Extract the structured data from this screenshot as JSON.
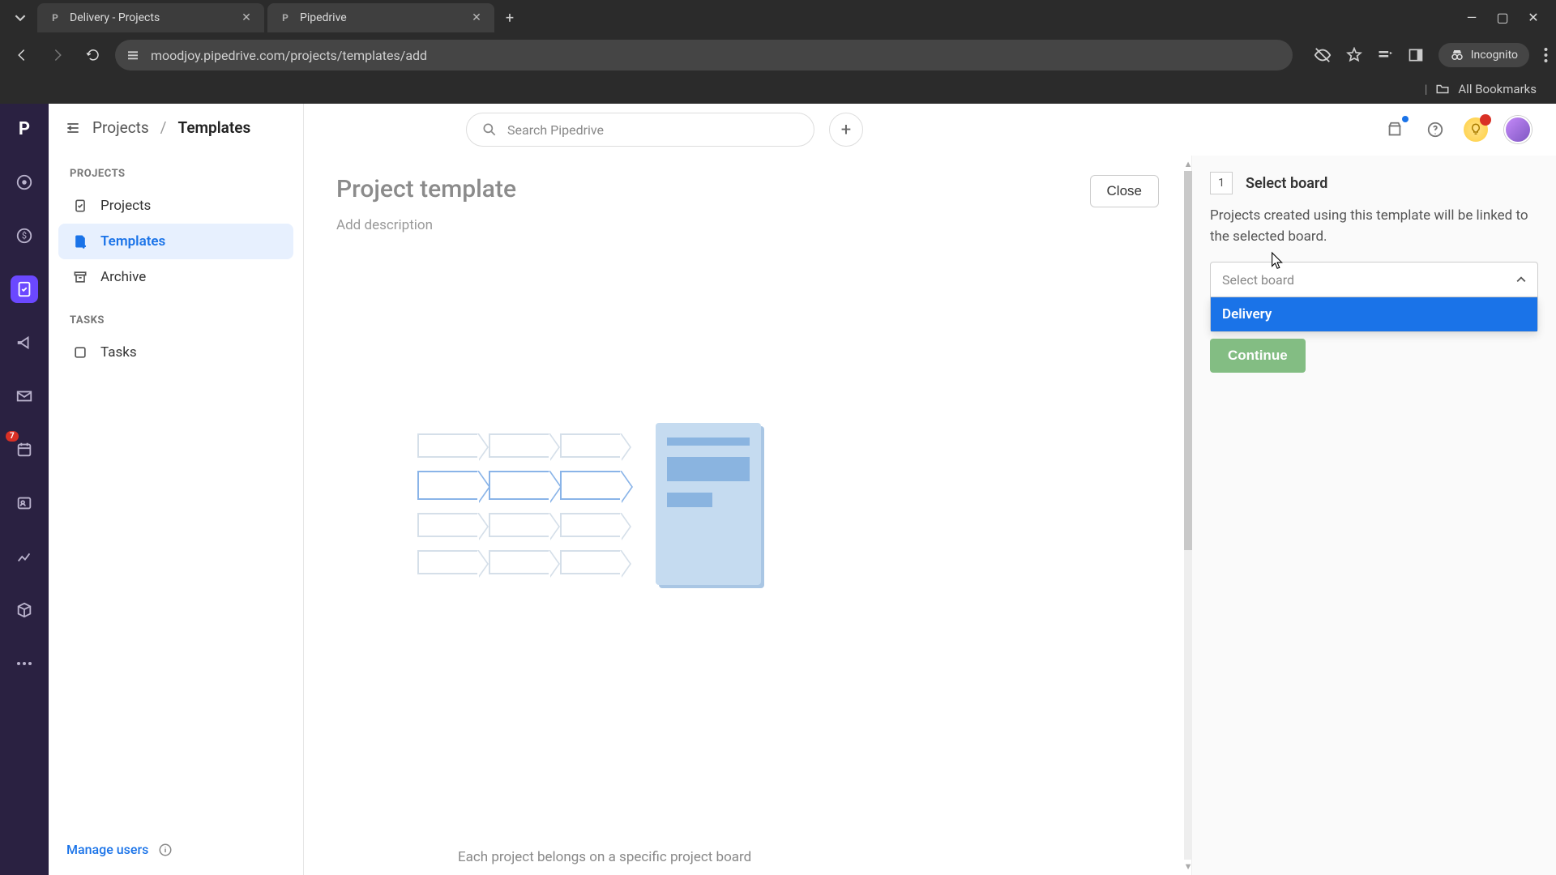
{
  "browser": {
    "tabs": [
      {
        "title": "Delivery - Projects"
      },
      {
        "title": "Pipedrive"
      }
    ],
    "url": "moodjoy.pipedrive.com/projects/templates/add",
    "incognito_label": "Incognito",
    "all_bookmarks": "All Bookmarks"
  },
  "rail": {
    "badge_count": "7"
  },
  "breadcrumb": {
    "root": "Projects",
    "current": "Templates"
  },
  "sidebar": {
    "projects_heading": "PROJECTS",
    "items": {
      "projects": "Projects",
      "templates": "Templates",
      "archive": "Archive"
    },
    "tasks_heading": "TASKS",
    "tasks_item": "Tasks",
    "manage_users": "Manage users"
  },
  "search": {
    "placeholder": "Search Pipedrive"
  },
  "main": {
    "title": "Project template",
    "close": "Close",
    "description_placeholder": "Add description",
    "illustration_caption": "Each project belongs on a specific project board"
  },
  "panel": {
    "step_number": "1",
    "step_title": "Select board",
    "step_desc": "Projects created using this template will be linked to the selected board.",
    "select_placeholder": "Select board",
    "options": {
      "delivery": "Delivery"
    },
    "continue": "Continue"
  }
}
